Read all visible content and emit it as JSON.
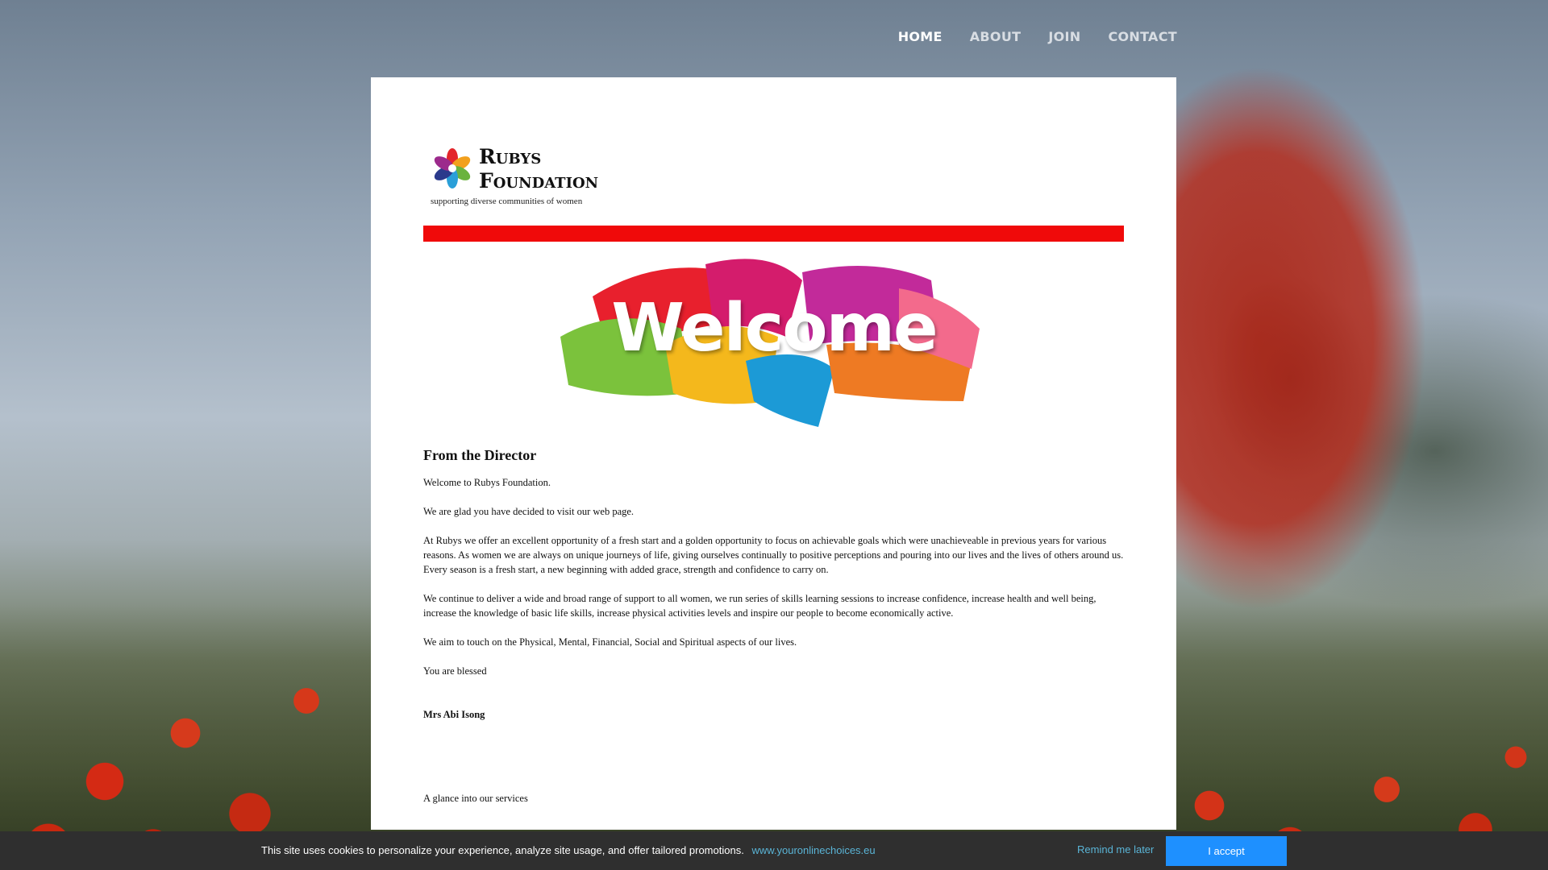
{
  "nav": {
    "items": [
      {
        "label": "HOME",
        "active": true
      },
      {
        "label": "ABOUT"
      },
      {
        "label": "JOIN"
      },
      {
        "label": "CONTACT"
      }
    ]
  },
  "logo": {
    "line1": "Rubys",
    "line2": "Foundation",
    "tagline": "supporting diverse communities of women"
  },
  "banner": {
    "color": "#f00a0a",
    "welcome_text": "Welcome"
  },
  "article": {
    "heading": "From the Director",
    "paragraphs": [
      "Welcome to Rubys Foundation.",
      "We are glad you have decided to visit our web page.",
      "At Rubys we offer an excellent opportunity of a fresh start and a golden opportunity to focus on achievable goals which were unachieveable in previous years for various reasons. As women we are always on unique journeys of life, giving ourselves continually to positive perceptions and pouring into our lives and the lives of others around us. Every season is a fresh start, a new beginning with added grace, strength and confidence to carry on.",
      "We continue to deliver a wide and broad range of support to all women, we run series of skills learning sessions to increase confidence, increase health and well being, increase the knowledge of basic life skills, increase physical activities levels and inspire our people to become economically active.",
      "We aim to touch on the Physical, Mental, Financial, Social and Spiritual aspects of our lives.",
      "You are blessed"
    ],
    "signature": "Mrs Abi Isong",
    "services_intro": "A glance into our services"
  },
  "cookie": {
    "message": "This site uses cookies to personalize your experience, analyze site usage, and offer tailored promotions.",
    "link": "www.youronlinechoices.eu",
    "remind_label": "Remind me later",
    "accept_label": "I accept",
    "accept_color": "#1e90ff"
  }
}
